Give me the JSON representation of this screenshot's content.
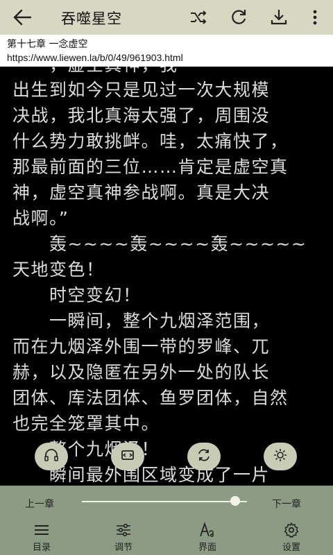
{
  "header": {
    "title": "吞噬星空",
    "icons": [
      "back-arrow-icon",
      "shuffle-icon",
      "refresh-icon",
      "download-icon",
      "more-vertical-icon"
    ]
  },
  "info": {
    "chapter": "第十七章 一念虚空",
    "url": "https://www.liewen.la/b/0/49/961903.html"
  },
  "content": {
    "lines": [
      "出生到如今只是见过一次大规模",
      "决战，我北真海太强了，周围没",
      "什么势力敢挑衅。哇，太痛快了，",
      "那最前面的三位……肯定是虚空真",
      "神，虚空真神参战啊。真是大决",
      "战啊。”",
      "　　轰~~~~轰~~~~轰~~~~~",
      "天地变色！",
      "　　时空变幻！",
      "　　一瞬间，整个九烟泽范围，",
      "而在九烟泽外围一带的罗峰、兀",
      "赫，以及隐匿在另外一处的队长",
      "团体、库法团体、鱼罗团体，自然",
      "也完全笼罩其中。",
      "　　整个九烟泽！",
      "　　瞬间最外围区域变成了一片"
    ]
  },
  "floating": [
    "headphones-icon",
    "screen-icon",
    "auto-scroll-icon",
    "brightness-icon"
  ],
  "bottom": {
    "prev": "上一章",
    "next": "下一章",
    "progress": 0.93,
    "items": [
      {
        "label": "目录",
        "icon": "menu-list-icon"
      },
      {
        "label": "调节",
        "icon": "sliders-icon"
      },
      {
        "label": "界面",
        "icon": "font-icon"
      },
      {
        "label": "设置",
        "icon": "gear-icon"
      }
    ]
  },
  "colors": {
    "toolbar": "#d6d8c2",
    "bottom": "#8b9b84",
    "text": "#dcdcdc"
  }
}
